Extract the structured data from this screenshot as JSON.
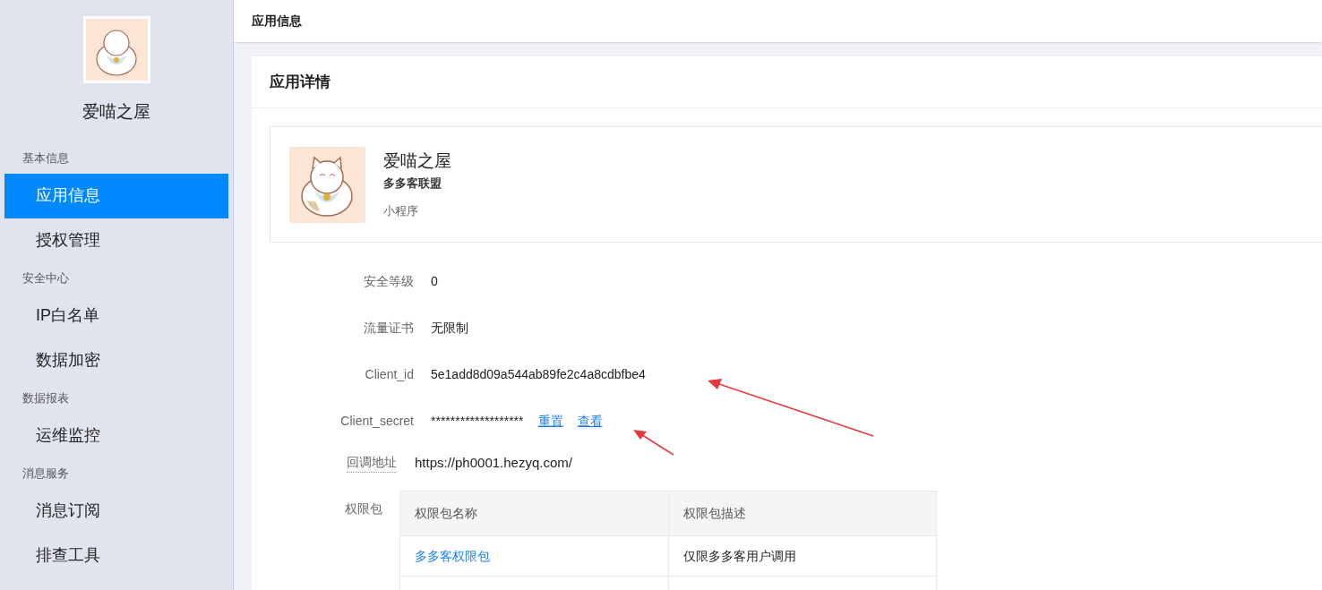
{
  "sidebar": {
    "app_name": "爱喵之屋",
    "groups": [
      {
        "title": "基本信息",
        "items": [
          {
            "label": "应用信息",
            "selected": true
          },
          {
            "label": "授权管理",
            "selected": false
          }
        ]
      },
      {
        "title": "安全中心",
        "items": [
          {
            "label": "IP白名单",
            "selected": false
          },
          {
            "label": "数据加密",
            "selected": false
          }
        ]
      },
      {
        "title": "数据报表",
        "items": [
          {
            "label": "运维监控",
            "selected": false
          }
        ]
      },
      {
        "title": "消息服务",
        "items": [
          {
            "label": "消息订阅",
            "selected": false
          },
          {
            "label": "排查工具",
            "selected": false
          }
        ]
      }
    ]
  },
  "header": {
    "title": "应用信息"
  },
  "card": {
    "title": "应用详情",
    "app": {
      "name": "爱喵之屋",
      "org": "多多客联盟",
      "type": "小程序"
    },
    "fields": [
      {
        "label": "安全等级",
        "value": "0"
      },
      {
        "label": "流量证书",
        "value": "无限制"
      },
      {
        "label": "Client_id",
        "value": "5e1add8d09a544ab89fe2c4a8cdbfbe4"
      },
      {
        "label": "Client_secret",
        "value": "*******************",
        "links": [
          "重置",
          "查看"
        ]
      }
    ],
    "callback": {
      "label": "回调地址",
      "value": "https://ph0001.hezyq.com/"
    },
    "permissions": {
      "label": "权限包",
      "columns": [
        "权限包名称",
        "权限包描述"
      ],
      "rows": [
        {
          "name": "多多客权限包",
          "description": "仅限多多客用户调用"
        }
      ]
    }
  }
}
